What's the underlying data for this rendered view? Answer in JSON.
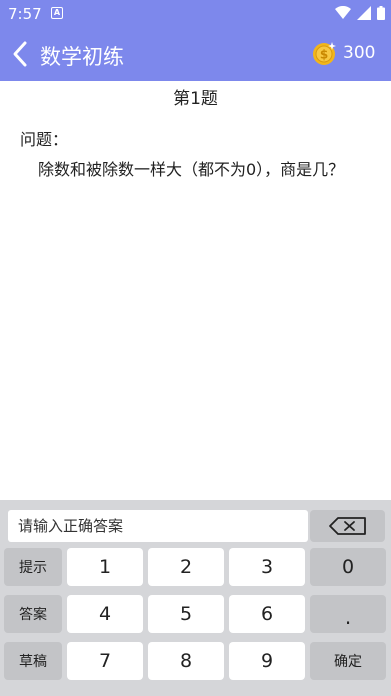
{
  "status_bar": {
    "time": "7:57",
    "notification_glyph": "A"
  },
  "app_bar": {
    "title": "数学初练",
    "coin_count": "300"
  },
  "question": {
    "number": "第1题",
    "label": "问题：",
    "text": "除数和被除数一样大（都不为0），商是几？"
  },
  "keypad": {
    "answer_placeholder": "请输入正确答案",
    "answer_value": "",
    "hint_label": "提示",
    "answer_label": "答案",
    "draft_label": "草稿",
    "confirm_label": "确定",
    "keys": {
      "k1": "1",
      "k2": "2",
      "k3": "3",
      "k0": "0",
      "k4": "4",
      "k5": "5",
      "k6": "6",
      "dot": ".",
      "k7": "7",
      "k8": "8",
      "k9": "9"
    }
  },
  "colors": {
    "primary": "#7d88ec",
    "keypad_bg": "#d5d6d9",
    "func_key": "#c3c4c7",
    "coin": "#f2b61a"
  }
}
